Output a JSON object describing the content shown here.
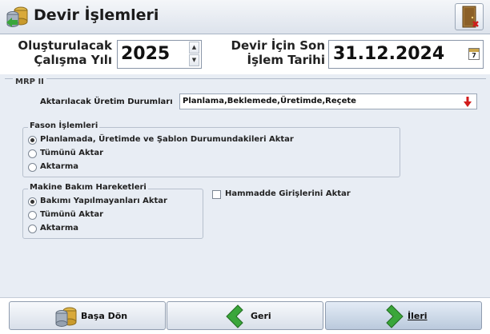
{
  "window": {
    "title": "Devir İşlemleri",
    "icon": "database-transfer-icon",
    "close_icon": "exit-door-icon"
  },
  "header": {
    "year_label_line1": "Oluşturulacak",
    "year_label_line2": "Çalışma Yılı",
    "year_value": "2025",
    "date_label_line1": "Devir İçin Son",
    "date_label_line2": "İşlem Tarihi",
    "date_value": "31.12.2024",
    "calendar_icon_text": "7"
  },
  "mrp": {
    "title": "MRP II",
    "production_label": "Aktarılacak Üretim Durumları",
    "production_value": "Planlama,Beklemede,Üretimde,Reçete",
    "fason": {
      "title": "Fason İşlemleri",
      "options": [
        "Planlamada, Üretimde ve Şablon Durumundakileri Aktar",
        "Tümünü Aktar",
        "Aktarma"
      ],
      "selected": 0
    },
    "maintenance": {
      "title": "Makine Bakım Hareketleri",
      "options": [
        "Bakımı Yapılmayanları Aktar",
        "Tümünü Aktar",
        "Aktarma"
      ],
      "selected": 0
    },
    "raw_material_checkbox": {
      "label": "Hammadde Girişlerini Aktar",
      "checked": false
    }
  },
  "footer": {
    "home_label": "Başa Dön",
    "back_label": "Geri",
    "next_label": "İleri"
  },
  "colors": {
    "accent_green": "#3aa63a",
    "window_bg": "#e8edf4",
    "arrow_red": "#d11b1b"
  }
}
